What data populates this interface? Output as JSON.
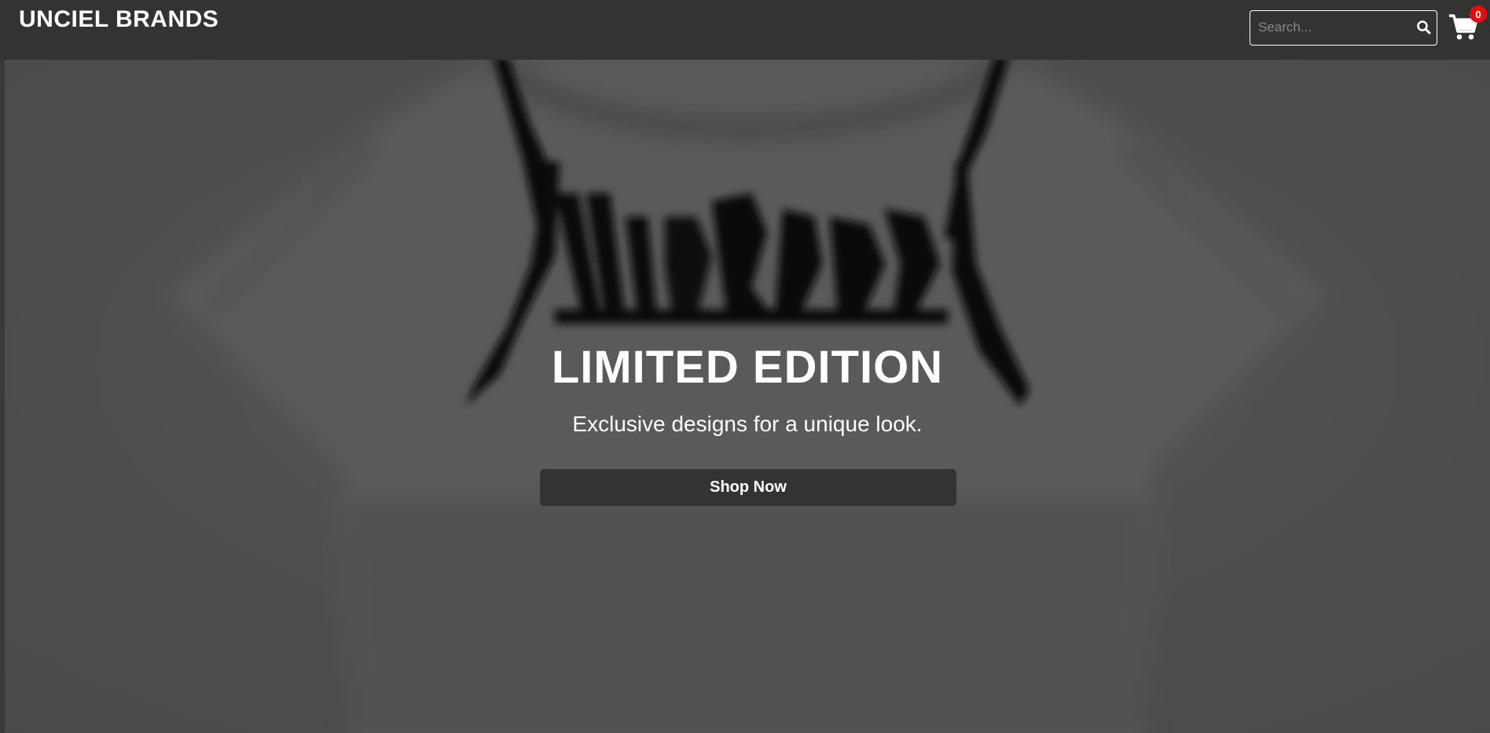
{
  "header": {
    "brand": "UNCIEL BRANDS",
    "search": {
      "placeholder": "Search...",
      "icon": "search-icon"
    },
    "cart": {
      "icon": "shopping-cart-icon",
      "count": "0"
    }
  },
  "hero": {
    "title": "LIMITED EDITION",
    "subtitle": "Exclusive designs for a unique look.",
    "cta_label": "Shop Now",
    "background": "blurred grey t-shirt with black logo print"
  },
  "colors": {
    "header_bg": "#333333",
    "hero_overlay": "#5f5f5f",
    "button_bg": "#333333",
    "badge": "#e01010",
    "text": "#ffffff"
  }
}
